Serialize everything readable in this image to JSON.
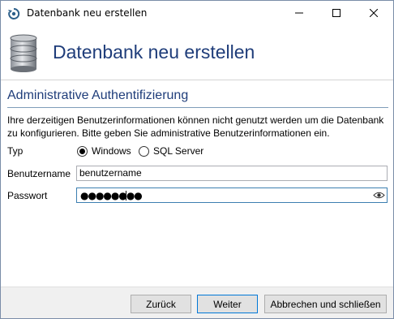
{
  "window": {
    "title": "Datenbank neu erstellen",
    "icons": {
      "app": "refresh-db-icon",
      "minimize": "minimize-icon",
      "maximize": "maximize-icon",
      "close": "close-icon"
    }
  },
  "header": {
    "title": "Datenbank neu erstellen",
    "icon": "database-icon"
  },
  "section": {
    "title": "Administrative Authentifizierung",
    "description": "Ihre derzeitigen Benutzerinformationen können nicht genutzt werden um die Datenbank zu konfigurieren. Bitte geben Sie administrative Benutzerinformationen ein."
  },
  "form": {
    "type_label": "Typ",
    "type_options": [
      {
        "label": "Windows",
        "selected": true
      },
      {
        "label": "SQL Server",
        "selected": false
      }
    ],
    "username_label": "Benutzername",
    "username_value": "benutzername",
    "password_label": "Passwort",
    "password_masked": "●●●●●●●●",
    "password_toggle_icon": "eye-icon"
  },
  "footer": {
    "back_label": "Zurück",
    "next_label": "Weiter",
    "cancel_label": "Abbrechen und schließen"
  },
  "colors": {
    "heading_blue": "#1f3d7a",
    "focus_border": "#0078d7",
    "footer_bg": "#f0f0f0"
  }
}
